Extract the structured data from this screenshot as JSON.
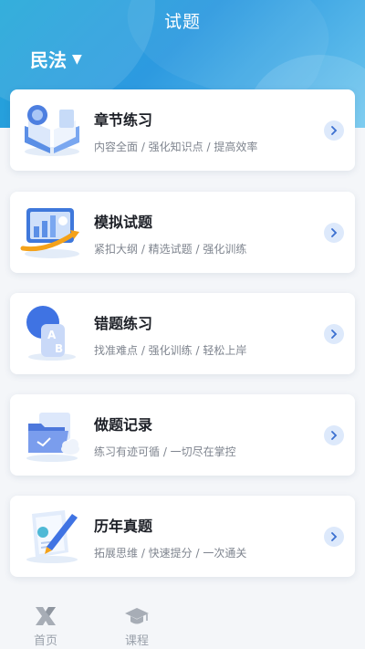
{
  "header": {
    "title": "试题",
    "subject_label": "民法",
    "subject_caret": "▼"
  },
  "cards": [
    {
      "name": "章节练习",
      "desc": "内容全面 / 强化知识点 / 提高效率",
      "icon": "open-book-icon"
    },
    {
      "name": "模拟试题",
      "desc": "紧扣大纲 / 精选试题 / 强化训练",
      "icon": "chart-board-icon"
    },
    {
      "name": "错题练习",
      "desc": "找准难点 / 强化训练 / 轻松上岸",
      "icon": "ab-cards-icon"
    },
    {
      "name": "做题记录",
      "desc": "练习有迹可循 / 一切尽在掌控",
      "icon": "folder-cloud-icon"
    },
    {
      "name": "历年真题",
      "desc": "拓展思维 / 快速提分 / 一次通关",
      "icon": "paper-pen-icon"
    }
  ],
  "tabbar": {
    "tabs": [
      {
        "label": "首页",
        "icon": "home-x-logo-icon"
      },
      {
        "label": "课程",
        "icon": "graduation-cap-icon"
      }
    ]
  },
  "colors": {
    "header_gradient_start": "#1ea6d8",
    "header_gradient_end": "#6dc6ee",
    "arrow_bg": "#dde9fb",
    "arrow_fg": "#3a6fd0",
    "tab_inactive": "#9aa1ab"
  }
}
